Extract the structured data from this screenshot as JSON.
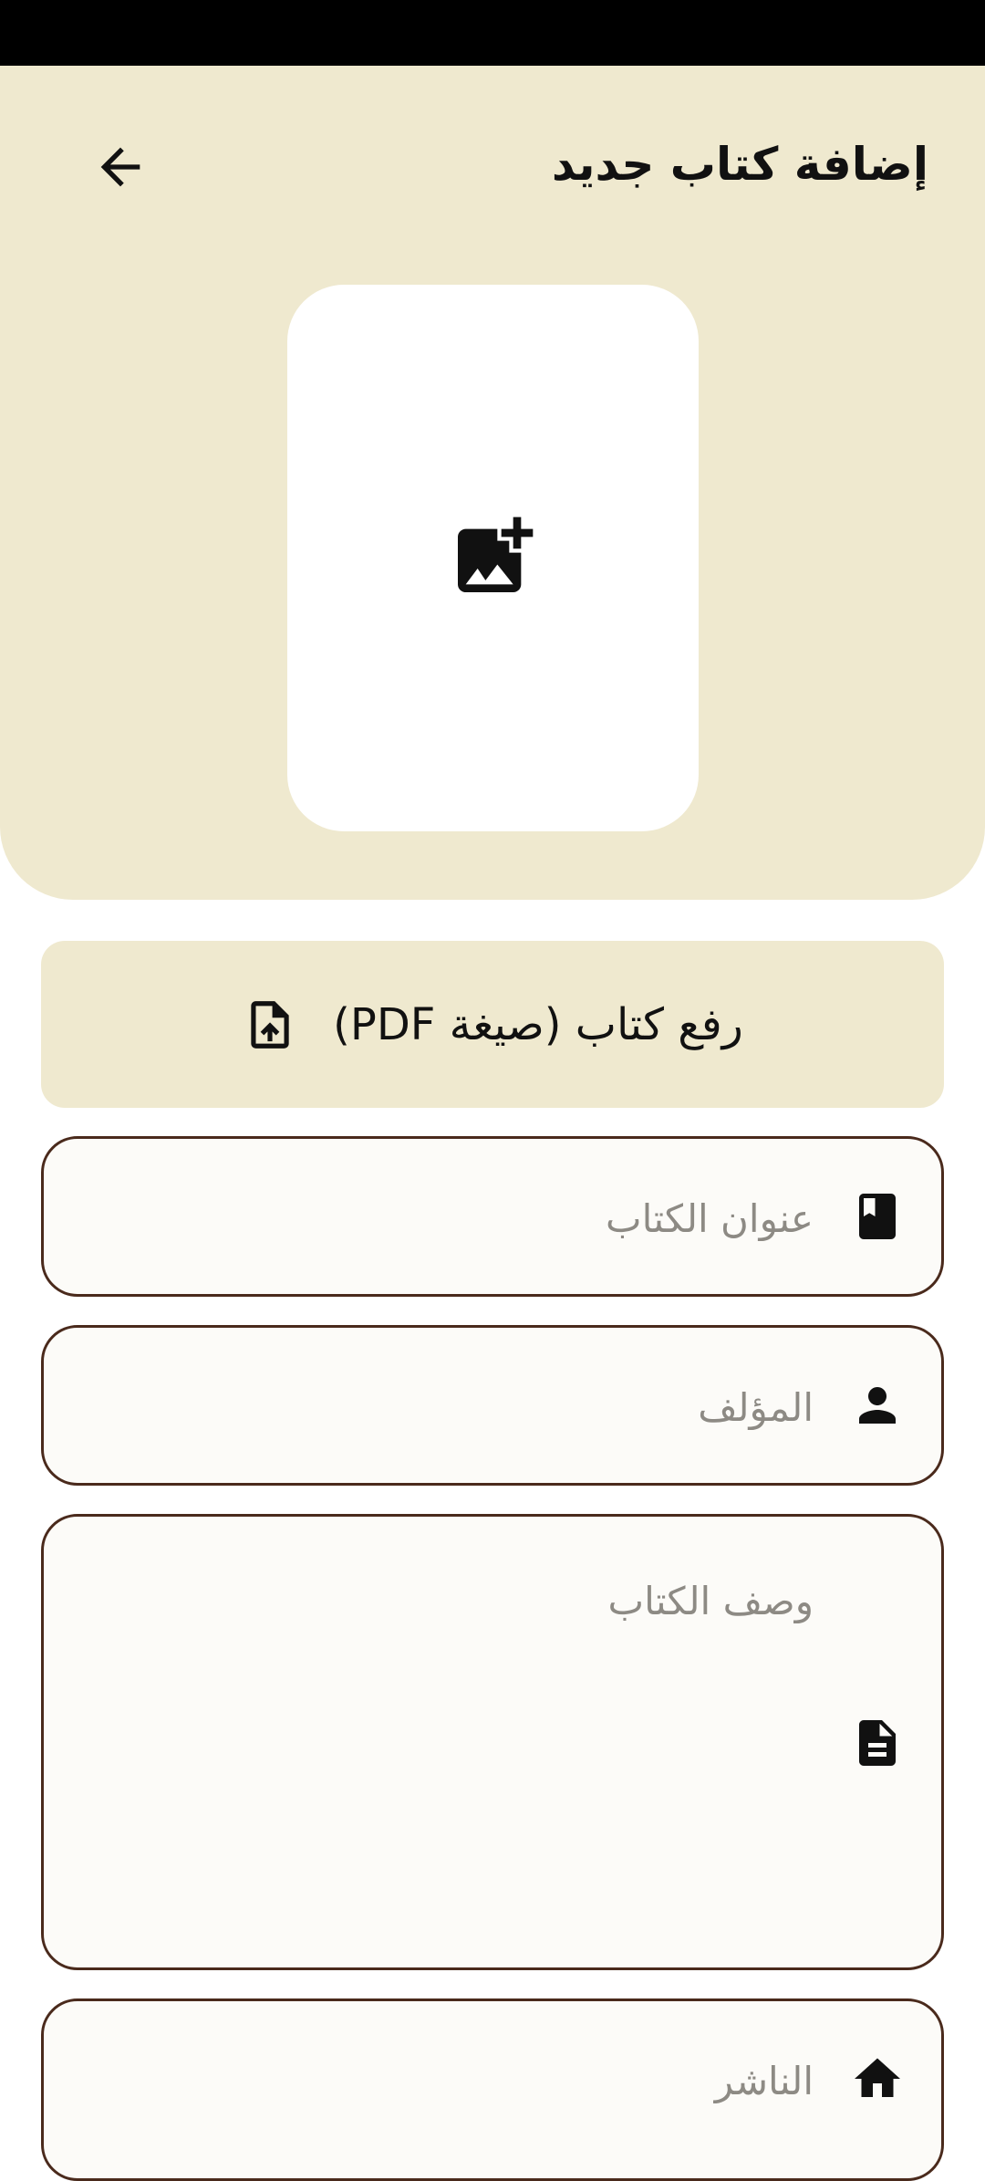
{
  "header": {
    "title": "إضافة كتاب جديد",
    "back_icon": "arrow-back-icon",
    "background": "#efe9cf"
  },
  "cover": {
    "icon": "add-photo-icon"
  },
  "upload": {
    "label": "رفع كتاب (صيغة PDF)",
    "icon": "file-upload-icon"
  },
  "form": {
    "title_field": {
      "placeholder": "عنوان الكتاب",
      "value": "",
      "icon": "book-icon"
    },
    "author_field": {
      "placeholder": "المؤلف",
      "value": "",
      "icon": "person-icon"
    },
    "description_field": {
      "placeholder": "وصف الكتاب",
      "value": "",
      "icon": "document-icon"
    },
    "publisher_field": {
      "placeholder": "الناشر",
      "value": "",
      "icon": "home-icon"
    }
  },
  "colors": {
    "accent": "#efe9cf",
    "border": "#4a2a1c",
    "field_bg": "#fcfbf8"
  }
}
